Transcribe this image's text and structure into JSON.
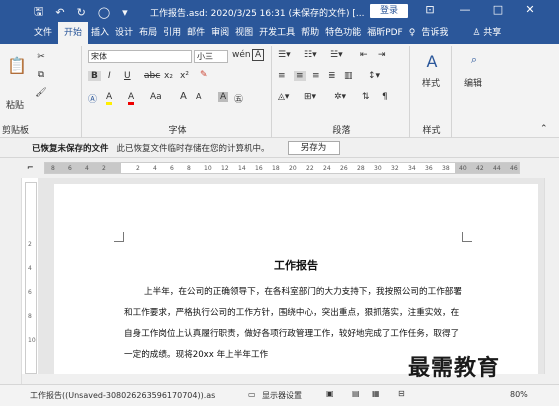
{
  "titlebar": {
    "title": "工作报告.asd: 2020/3/25 16:31 (未保存的文件) [...",
    "login": "登录",
    "ribbon_display": "⊡",
    "minimize": "—",
    "maximize": "□",
    "close": "✕",
    "bg_color": "#2b579a"
  },
  "tabs": [
    "文件",
    "开始",
    "插入",
    "设计",
    "布局",
    "引用",
    "邮件",
    "审阅",
    "视图",
    "开发工具",
    "帮助",
    "特色功能",
    "福昕PDF",
    "告诉我",
    "共享"
  ],
  "active_tab": "开始",
  "ribbon": {
    "clipboard": {
      "label": "剪贴板",
      "paste": "粘贴"
    },
    "font": {
      "label": "字体",
      "font_name": "宋体",
      "font_size": "小三",
      "wen": "wén",
      "bold": "B",
      "italic": "I",
      "underline": "U",
      "strike": "abc",
      "sub": "x₂",
      "sup": "x²",
      "aa": "Aa",
      "grow": "A",
      "shrink": "A",
      "char_a": "A",
      "highlight": "A",
      "color_a": "A"
    },
    "paragraph": {
      "label": "段落"
    },
    "styles": {
      "label": "样式",
      "button": "样式"
    },
    "editing": {
      "label": "编辑",
      "button": "编辑"
    }
  },
  "infobar": {
    "title": "已恢复未保存的文件",
    "message": "此已恢复文件临时存储在您的计算机中。",
    "save_as": "另存为"
  },
  "ruler": {
    "ticks": [
      "8",
      "6",
      "4",
      "2",
      "",
      "2",
      "4",
      "6",
      "8",
      "10",
      "12",
      "14",
      "16",
      "18",
      "20",
      "22",
      "24",
      "26",
      "28",
      "30",
      "32",
      "34",
      "36",
      "38",
      "40",
      "42",
      "44",
      "46"
    ]
  },
  "vruler": {
    "ticks": [
      "2",
      "4",
      "6",
      "8",
      "10"
    ]
  },
  "document": {
    "title": "工作报告",
    "paragraph": "上半年，在公司的正确领导下，在各科室部门的大力支持下，我按照公司的工作部署和工作要求，严格执行公司的工作方针，围绕中心，突出重点，狠抓落实，注重实效，在自身工作岗位上认真履行职责，做好各项行政管理工作，较好地完成了工作任务，取得了一定的成绩。现将20xx 年上半年工作"
  },
  "statusbar": {
    "doc": "工作报告((Unsaved-308026263596170704)).as",
    "accessibility": "显示器设置",
    "zoom": "80%"
  },
  "watermark": "最需教育"
}
